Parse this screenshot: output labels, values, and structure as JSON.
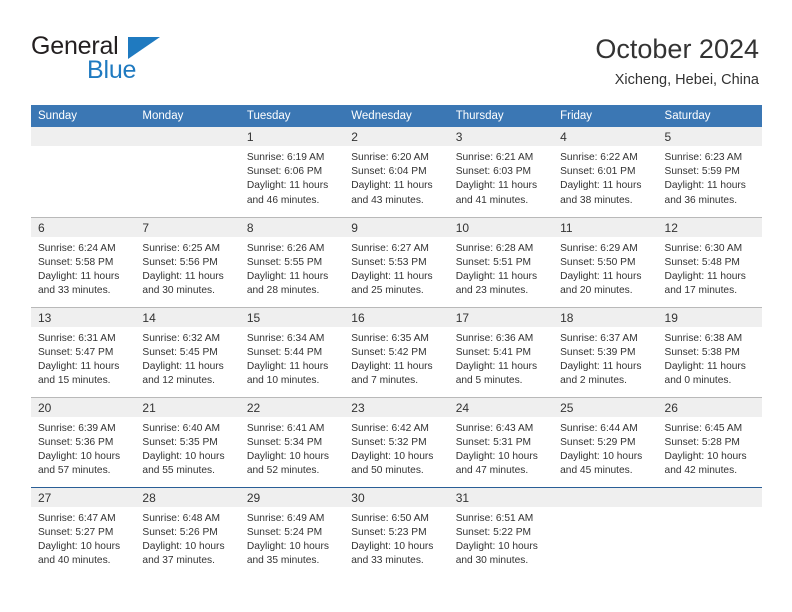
{
  "brand": {
    "name_part1": "General",
    "name_part2": "Blue"
  },
  "header": {
    "title": "October 2024",
    "subtitle": "Xicheng, Hebei, China"
  },
  "colors": {
    "header_blue": "#3b77b4",
    "brand_blue": "#1f7ac0",
    "daynum_band": "#efefef",
    "grid_line": "#b9b9b9",
    "text": "#333333"
  },
  "weekday_headers": [
    "Sunday",
    "Monday",
    "Tuesday",
    "Wednesday",
    "Thursday",
    "Friday",
    "Saturday"
  ],
  "labels": {
    "sunrise_prefix": "Sunrise:",
    "sunset_prefix": "Sunset:",
    "daylight_prefix": "Daylight:"
  },
  "weeks": [
    [
      {
        "day": "",
        "empty": true,
        "l1": "",
        "l2": "",
        "l3": "",
        "l4": ""
      },
      {
        "day": "",
        "empty": true,
        "l1": "",
        "l2": "",
        "l3": "",
        "l4": ""
      },
      {
        "day": "1",
        "l1": "Sunrise: 6:19 AM",
        "l2": "Sunset: 6:06 PM",
        "l3": "Daylight: 11 hours",
        "l4": "and 46 minutes."
      },
      {
        "day": "2",
        "l1": "Sunrise: 6:20 AM",
        "l2": "Sunset: 6:04 PM",
        "l3": "Daylight: 11 hours",
        "l4": "and 43 minutes."
      },
      {
        "day": "3",
        "l1": "Sunrise: 6:21 AM",
        "l2": "Sunset: 6:03 PM",
        "l3": "Daylight: 11 hours",
        "l4": "and 41 minutes."
      },
      {
        "day": "4",
        "l1": "Sunrise: 6:22 AM",
        "l2": "Sunset: 6:01 PM",
        "l3": "Daylight: 11 hours",
        "l4": "and 38 minutes."
      },
      {
        "day": "5",
        "l1": "Sunrise: 6:23 AM",
        "l2": "Sunset: 5:59 PM",
        "l3": "Daylight: 11 hours",
        "l4": "and 36 minutes."
      }
    ],
    [
      {
        "day": "6",
        "l1": "Sunrise: 6:24 AM",
        "l2": "Sunset: 5:58 PM",
        "l3": "Daylight: 11 hours",
        "l4": "and 33 minutes."
      },
      {
        "day": "7",
        "l1": "Sunrise: 6:25 AM",
        "l2": "Sunset: 5:56 PM",
        "l3": "Daylight: 11 hours",
        "l4": "and 30 minutes."
      },
      {
        "day": "8",
        "l1": "Sunrise: 6:26 AM",
        "l2": "Sunset: 5:55 PM",
        "l3": "Daylight: 11 hours",
        "l4": "and 28 minutes."
      },
      {
        "day": "9",
        "l1": "Sunrise: 6:27 AM",
        "l2": "Sunset: 5:53 PM",
        "l3": "Daylight: 11 hours",
        "l4": "and 25 minutes."
      },
      {
        "day": "10",
        "l1": "Sunrise: 6:28 AM",
        "l2": "Sunset: 5:51 PM",
        "l3": "Daylight: 11 hours",
        "l4": "and 23 minutes."
      },
      {
        "day": "11",
        "l1": "Sunrise: 6:29 AM",
        "l2": "Sunset: 5:50 PM",
        "l3": "Daylight: 11 hours",
        "l4": "and 20 minutes."
      },
      {
        "day": "12",
        "l1": "Sunrise: 6:30 AM",
        "l2": "Sunset: 5:48 PM",
        "l3": "Daylight: 11 hours",
        "l4": "and 17 minutes."
      }
    ],
    [
      {
        "day": "13",
        "l1": "Sunrise: 6:31 AM",
        "l2": "Sunset: 5:47 PM",
        "l3": "Daylight: 11 hours",
        "l4": "and 15 minutes."
      },
      {
        "day": "14",
        "l1": "Sunrise: 6:32 AM",
        "l2": "Sunset: 5:45 PM",
        "l3": "Daylight: 11 hours",
        "l4": "and 12 minutes."
      },
      {
        "day": "15",
        "l1": "Sunrise: 6:34 AM",
        "l2": "Sunset: 5:44 PM",
        "l3": "Daylight: 11 hours",
        "l4": "and 10 minutes."
      },
      {
        "day": "16",
        "l1": "Sunrise: 6:35 AM",
        "l2": "Sunset: 5:42 PM",
        "l3": "Daylight: 11 hours",
        "l4": "and 7 minutes."
      },
      {
        "day": "17",
        "l1": "Sunrise: 6:36 AM",
        "l2": "Sunset: 5:41 PM",
        "l3": "Daylight: 11 hours",
        "l4": "and 5 minutes."
      },
      {
        "day": "18",
        "l1": "Sunrise: 6:37 AM",
        "l2": "Sunset: 5:39 PM",
        "l3": "Daylight: 11 hours",
        "l4": "and 2 minutes."
      },
      {
        "day": "19",
        "l1": "Sunrise: 6:38 AM",
        "l2": "Sunset: 5:38 PM",
        "l3": "Daylight: 11 hours",
        "l4": "and 0 minutes."
      }
    ],
    [
      {
        "day": "20",
        "l1": "Sunrise: 6:39 AM",
        "l2": "Sunset: 5:36 PM",
        "l3": "Daylight: 10 hours",
        "l4": "and 57 minutes."
      },
      {
        "day": "21",
        "l1": "Sunrise: 6:40 AM",
        "l2": "Sunset: 5:35 PM",
        "l3": "Daylight: 10 hours",
        "l4": "and 55 minutes."
      },
      {
        "day": "22",
        "l1": "Sunrise: 6:41 AM",
        "l2": "Sunset: 5:34 PM",
        "l3": "Daylight: 10 hours",
        "l4": "and 52 minutes."
      },
      {
        "day": "23",
        "l1": "Sunrise: 6:42 AM",
        "l2": "Sunset: 5:32 PM",
        "l3": "Daylight: 10 hours",
        "l4": "and 50 minutes."
      },
      {
        "day": "24",
        "l1": "Sunrise: 6:43 AM",
        "l2": "Sunset: 5:31 PM",
        "l3": "Daylight: 10 hours",
        "l4": "and 47 minutes."
      },
      {
        "day": "25",
        "l1": "Sunrise: 6:44 AM",
        "l2": "Sunset: 5:29 PM",
        "l3": "Daylight: 10 hours",
        "l4": "and 45 minutes."
      },
      {
        "day": "26",
        "l1": "Sunrise: 6:45 AM",
        "l2": "Sunset: 5:28 PM",
        "l3": "Daylight: 10 hours",
        "l4": "and 42 minutes."
      }
    ],
    [
      {
        "day": "27",
        "l1": "Sunrise: 6:47 AM",
        "l2": "Sunset: 5:27 PM",
        "l3": "Daylight: 10 hours",
        "l4": "and 40 minutes."
      },
      {
        "day": "28",
        "l1": "Sunrise: 6:48 AM",
        "l2": "Sunset: 5:26 PM",
        "l3": "Daylight: 10 hours",
        "l4": "and 37 minutes."
      },
      {
        "day": "29",
        "l1": "Sunrise: 6:49 AM",
        "l2": "Sunset: 5:24 PM",
        "l3": "Daylight: 10 hours",
        "l4": "and 35 minutes."
      },
      {
        "day": "30",
        "l1": "Sunrise: 6:50 AM",
        "l2": "Sunset: 5:23 PM",
        "l3": "Daylight: 10 hours",
        "l4": "and 33 minutes."
      },
      {
        "day": "31",
        "l1": "Sunrise: 6:51 AM",
        "l2": "Sunset: 5:22 PM",
        "l3": "Daylight: 10 hours",
        "l4": "and 30 minutes."
      },
      {
        "day": "",
        "empty": true,
        "l1": "",
        "l2": "",
        "l3": "",
        "l4": ""
      },
      {
        "day": "",
        "empty": true,
        "l1": "",
        "l2": "",
        "l3": "",
        "l4": ""
      }
    ]
  ]
}
